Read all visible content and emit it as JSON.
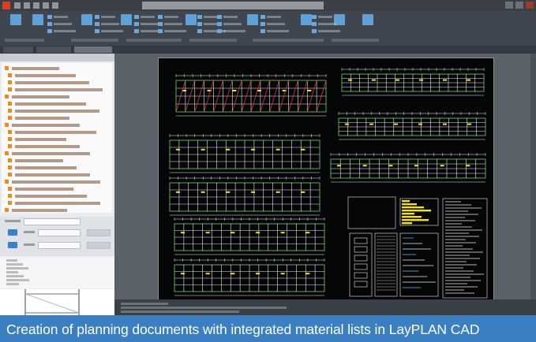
{
  "caption": {
    "text": "Creation of planning documents with integrated material lists in LayPLAN CAD"
  },
  "colors": {
    "caption_background": "#3a7fc2",
    "caption_text": "#ffffff",
    "drawing_background": "#050607",
    "model_space": "#5b6169",
    "ribbon": "#3f4650",
    "accent_orange": "#e88d1e",
    "drawing_highlight_yellow": "#f2e11c",
    "drawing_red": "#d63a3a",
    "drawing_green": "#6fd06f"
  },
  "icons": {
    "app": "application-logo-icon",
    "ribbon": "ribbon-tool-icon",
    "tree_item": "folder-icon"
  }
}
